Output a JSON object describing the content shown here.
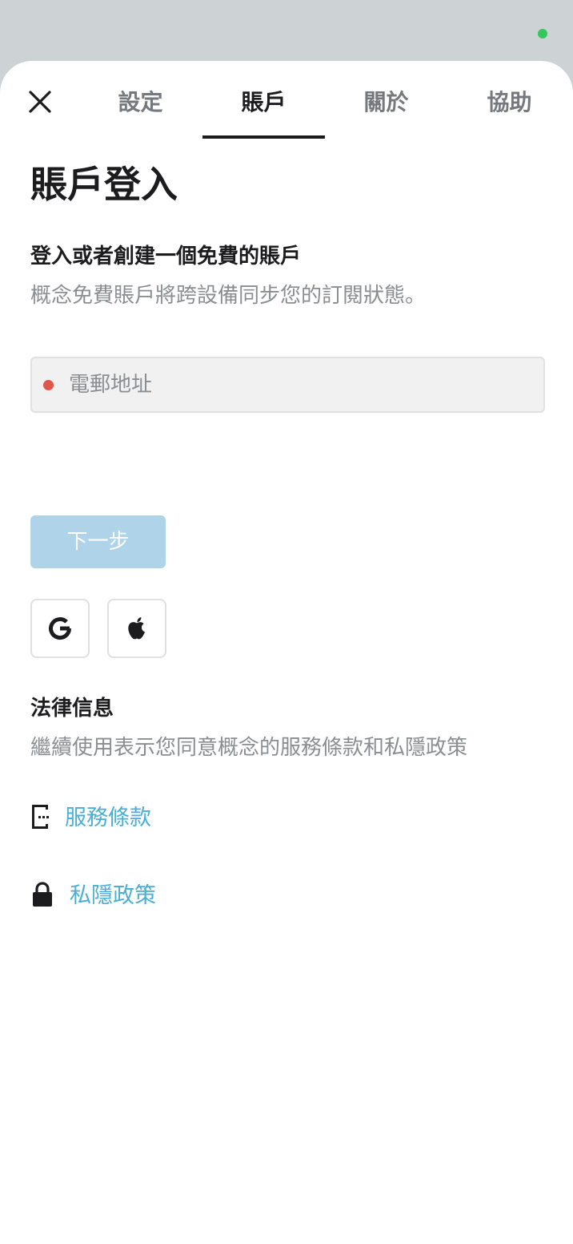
{
  "colors": {
    "status_dot": "#34c759",
    "required_dot": "#e0564a",
    "next_button_bg": "#afd4ea",
    "link": "#4aaed6"
  },
  "tabs": [
    {
      "label": "設定"
    },
    {
      "label": "賬戶",
      "active": true
    },
    {
      "label": "關於"
    },
    {
      "label": "協助"
    }
  ],
  "page": {
    "title": "賬戶登入",
    "subtitle_heading": "登入或者創建一個免費的賬戶",
    "subtitle_text": "概念免費賬戶將跨設備同步您的訂閱狀態。"
  },
  "email": {
    "placeholder": "電郵地址",
    "value": ""
  },
  "next_button": {
    "label": "下一步"
  },
  "social": {
    "google_icon": "google-icon",
    "apple_icon": "apple-icon"
  },
  "legal": {
    "heading": "法律信息",
    "text": "繼續使用表示您同意概念的服務條款和私隱政策",
    "links": [
      {
        "label": "服務條款",
        "icon": "document-icon"
      },
      {
        "label": "私隱政策",
        "icon": "lock-icon"
      }
    ]
  }
}
